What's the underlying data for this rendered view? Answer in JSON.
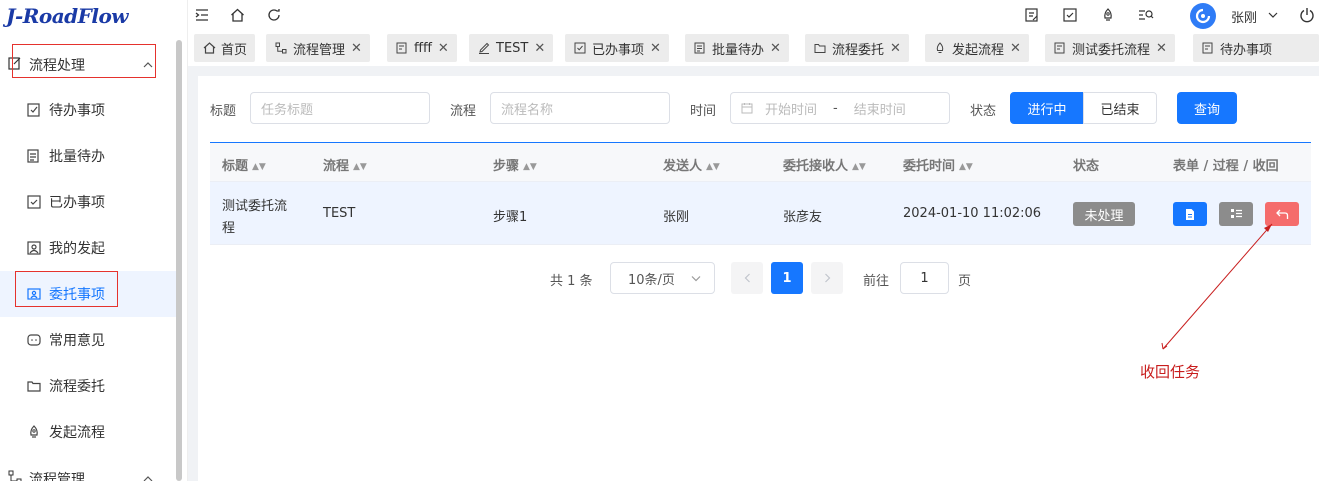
{
  "app": {
    "logo": "J-RoadFlow"
  },
  "sidebar": {
    "group_process": "流程处理",
    "items": [
      {
        "label": "待办事项",
        "icon": "todo-icon"
      },
      {
        "label": "批量待办",
        "icon": "batch-icon"
      },
      {
        "label": "已办事项",
        "icon": "done-icon"
      },
      {
        "label": "我的发起",
        "icon": "my-start-icon"
      },
      {
        "label": "委托事项",
        "icon": "entrust-icon"
      },
      {
        "label": "常用意见",
        "icon": "comment-icon"
      },
      {
        "label": "流程委托",
        "icon": "folder-icon"
      },
      {
        "label": "发起流程",
        "icon": "rocket-icon"
      }
    ],
    "group_manage": "流程管理"
  },
  "topbar": {
    "user": "张刚"
  },
  "tabs": [
    {
      "label": "首页",
      "closable": false
    },
    {
      "label": "流程管理",
      "closable": true
    },
    {
      "label": "ffff",
      "closable": true
    },
    {
      "label": "TEST",
      "closable": true
    },
    {
      "label": "已办事项",
      "closable": true
    },
    {
      "label": "批量待办",
      "closable": true
    },
    {
      "label": "流程委托",
      "closable": true
    },
    {
      "label": "发起流程",
      "closable": true
    },
    {
      "label": "测试委托流程",
      "closable": true
    },
    {
      "label": "待办事项",
      "closable": false
    }
  ],
  "filters": {
    "title_label": "标题",
    "title_placeholder": "任务标题",
    "flow_label": "流程",
    "flow_placeholder": "流程名称",
    "time_label": "时间",
    "time_start": "开始时间",
    "time_sep": "-",
    "time_end": "结束时间",
    "status_label": "状态",
    "status_ongoing": "进行中",
    "status_finished": "已结束",
    "query": "查询"
  },
  "table": {
    "headers": [
      "标题",
      "流程",
      "步骤",
      "发送人",
      "委托接收人",
      "委托时间",
      "状态",
      "表单 / 过程 / 收回"
    ],
    "rows": [
      {
        "title_line1": "测试委托流",
        "title_line2": "程",
        "flow": "TEST",
        "step": "步骤1",
        "sender": "张刚",
        "receiver": "张彦友",
        "time": "2024-01-10 11:02:06",
        "status": "未处理"
      }
    ]
  },
  "pagination": {
    "total": "共 1 条",
    "page_size": "10条/页",
    "current": "1",
    "goto_label": "前往",
    "goto_value": "1",
    "page_unit": "页"
  },
  "annotation": {
    "text": "收回任务"
  },
  "colors": {
    "primary": "#1677ff",
    "danger": "#f56c6c",
    "info": "#8c8c8c",
    "annotation": "#c81e1e"
  }
}
